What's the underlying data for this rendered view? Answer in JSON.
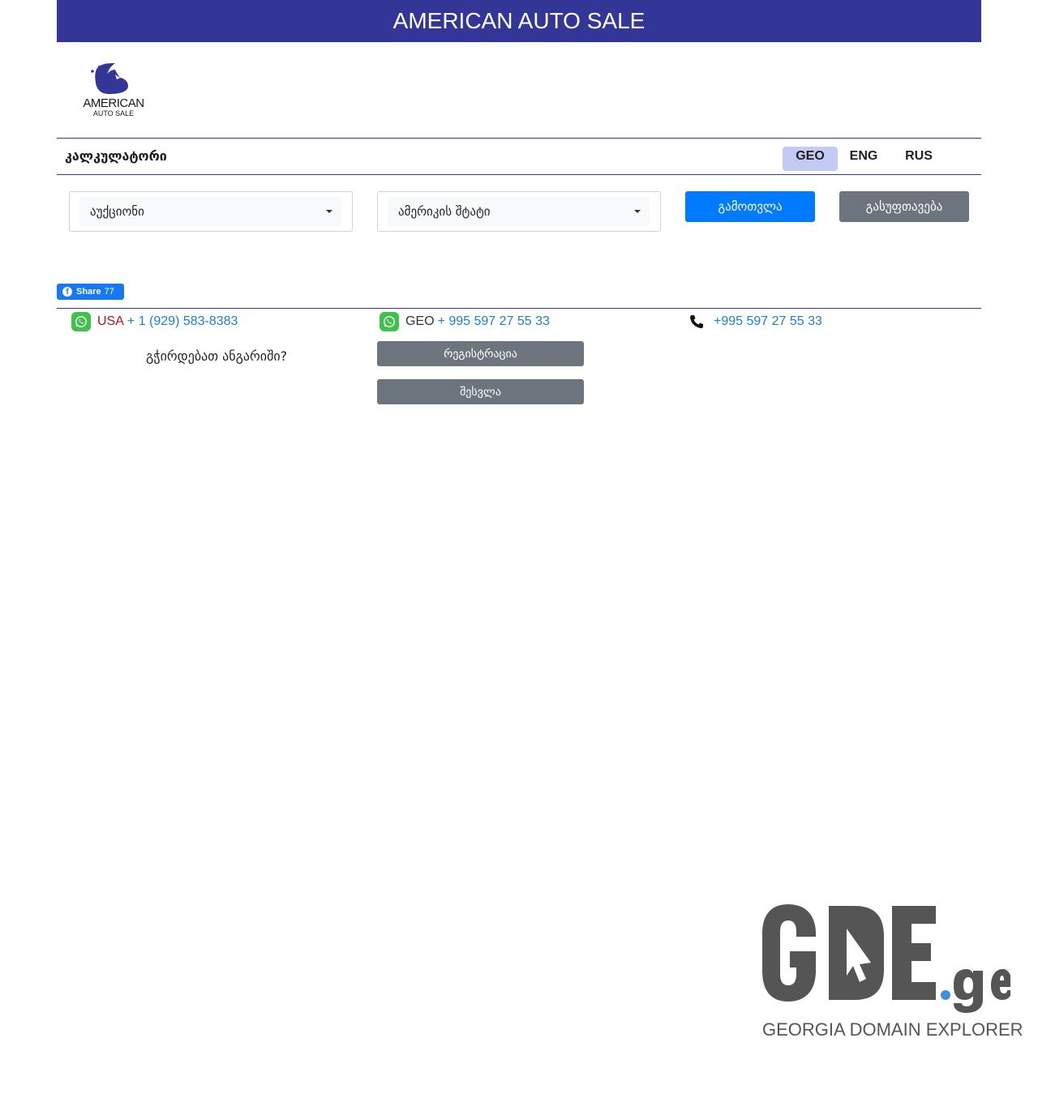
{
  "banner": {
    "title": "AMERICAN AUTO SALE"
  },
  "logo": {
    "line1": "AMERICAN",
    "line2": "AUTO SALE",
    "icon": "eagle-icon",
    "color": "#333697"
  },
  "navbar": {
    "title": "კალკულატორი",
    "languages": [
      {
        "label": "GEO",
        "active": true
      },
      {
        "label": "ENG",
        "active": false
      },
      {
        "label": "RUS",
        "active": false
      }
    ]
  },
  "calculator": {
    "auction_select": {
      "value": "აუქციონი"
    },
    "state_select": {
      "value": "ამერიკის შტატი"
    },
    "calculate_label": "გამოთვლა",
    "clear_label": "გასუფთავება"
  },
  "share": {
    "label": "Share",
    "count": "77"
  },
  "contacts": {
    "usa": {
      "label": "USA",
      "phone": "+ 1 (929) 583-8383"
    },
    "geo": {
      "label": "GEO",
      "phone": "+ 995 597 27 55 33"
    },
    "call": {
      "phone": "+995 597 27 55 33"
    }
  },
  "account": {
    "question": "გჭირდებათ ანგარიში?",
    "register_label": "რეგისტრაცია",
    "login_label": "შესვლა"
  },
  "watermark": {
    "tagline": "GEORGIA DOMAIN EXPLORER",
    "brand": "GDE",
    "suffix": ".ge"
  },
  "colors": {
    "brand": "#333697",
    "primary": "#007bff",
    "secondary": "#6c757d",
    "whatsapp": "#3ec24b"
  }
}
